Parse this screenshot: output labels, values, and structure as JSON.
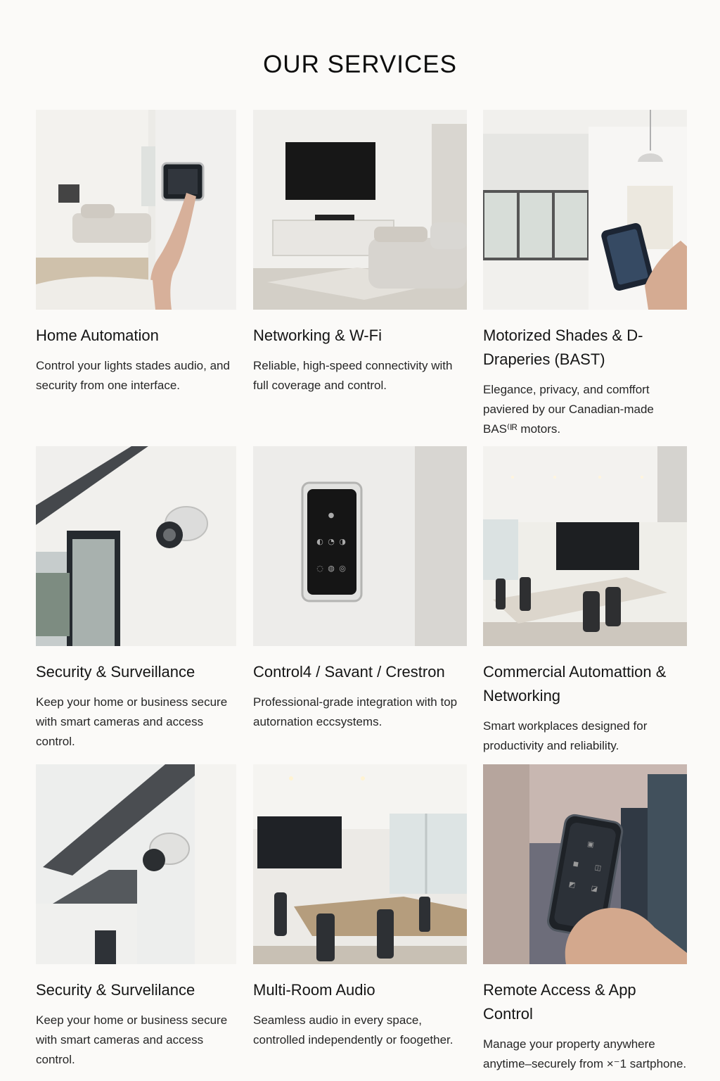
{
  "page": {
    "title": "OUR SERVICES"
  },
  "services": [
    {
      "title": "Home Automation",
      "description": "Control your lights stades audio, and security from one interface."
    },
    {
      "title": "Networking & W-Fi",
      "description": "Reliable, high-speed connectivity with full coverage and control."
    },
    {
      "title": "Motorized Shades & D-Draperies (BAST)",
      "description": "Elegance, privacy, and comffort paviered by our Canadian-made BAS⁽ᴵᴿ motors."
    },
    {
      "title": "Security & Surveillance",
      "description": "Keep your home or business secure with smart cameras and access control."
    },
    {
      "title": "Control4 / Savant / Crestron",
      "description": "Professional-grade integration with top autornation eccsystems."
    },
    {
      "title": "Commercial Automattion & Networking",
      "description": "Smart workplaces designed for productivity and reliability."
    },
    {
      "title": "Security & Survelilance",
      "description": "Keep your home or business secure with smart cameras and access control."
    },
    {
      "title": "Multi-Room Audio",
      "description": "Seamless audio in every space, controlled independently or foogether."
    },
    {
      "title": "Remote Access & App Control",
      "description": "Manage your property anywhere anytime–securely from ×⁻1 sartphone."
    }
  ]
}
